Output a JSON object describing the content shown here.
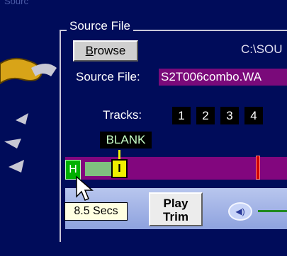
{
  "cut_label": "Sourc",
  "source_group": {
    "title": "Source File",
    "browse_label": "Browse",
    "browse_underlined": "B",
    "browse_rest": "rowse",
    "path_text": "C:\\SOU",
    "source_label": "Source File:",
    "source_value": "S2T006combo.WA"
  },
  "tracks": {
    "label": "Tracks:",
    "buttons": [
      "1",
      "2",
      "3",
      "4"
    ],
    "selected_name": "BLANK"
  },
  "timeline": {
    "marker_h": "H",
    "marker_i": "I"
  },
  "toolbar": {
    "play_trim_line1": "Play",
    "play_trim_line2": "Trim",
    "volume_icon": "speaker-icon"
  },
  "tooltip": {
    "text": "8.5 Secs"
  },
  "colors": {
    "background": "#000c5a",
    "timeline": "#82067e",
    "source_value_bg": "#7a0a7a",
    "marker_h": "#00b000",
    "marker_i": "#f0f000",
    "end_marker": "#d00000"
  }
}
